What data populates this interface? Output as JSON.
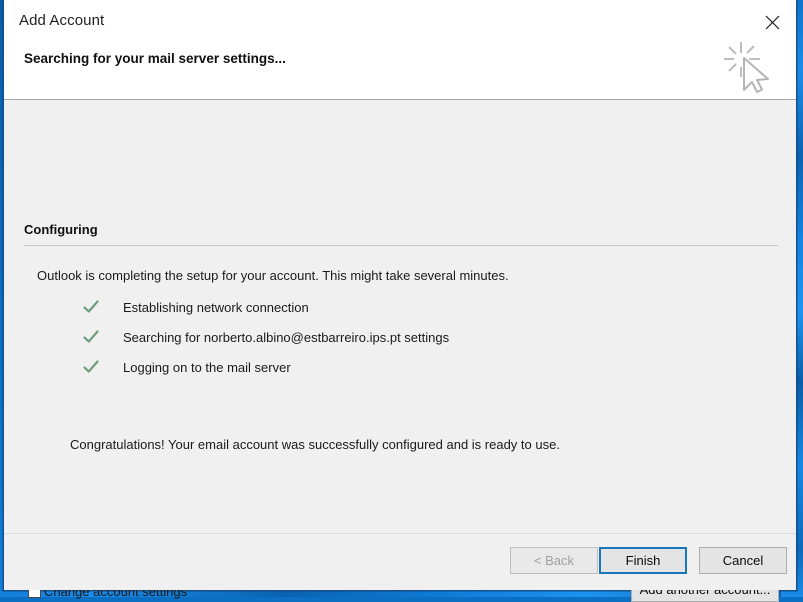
{
  "window": {
    "title": "Add Account",
    "close_icon": "close-icon",
    "heading": "Searching for your mail server settings...",
    "art_icon": "searching-cursor-icon"
  },
  "section": {
    "title": "Configuring",
    "intro": "Outlook is completing the setup for your account. This might take several minutes.",
    "steps": [
      {
        "icon": "checkmark-icon",
        "label": "Establishing network connection"
      },
      {
        "icon": "checkmark-icon",
        "label": "Searching for norberto.albino@estbarreiro.ips.pt settings"
      },
      {
        "icon": "checkmark-icon",
        "label": "Logging on to the mail server"
      }
    ],
    "success": "Congratulations! Your email account was successfully configured and is ready to use."
  },
  "options": {
    "change_account_settings_label": "Change account settings",
    "change_account_settings_checked": false,
    "add_another_account_label": "Add another account..."
  },
  "footer": {
    "back_label": "< Back",
    "back_disabled": true,
    "finish_label": "Finish",
    "finish_is_default": true,
    "cancel_label": "Cancel"
  },
  "colors": {
    "accent_blue": "#1a76bc",
    "window_border": "#1a4f8a",
    "dialog_bg": "#f0f0f0",
    "header_bg": "#ffffff",
    "check_green": "#6f9c7e",
    "desktop_blue": "#0d72cc"
  }
}
